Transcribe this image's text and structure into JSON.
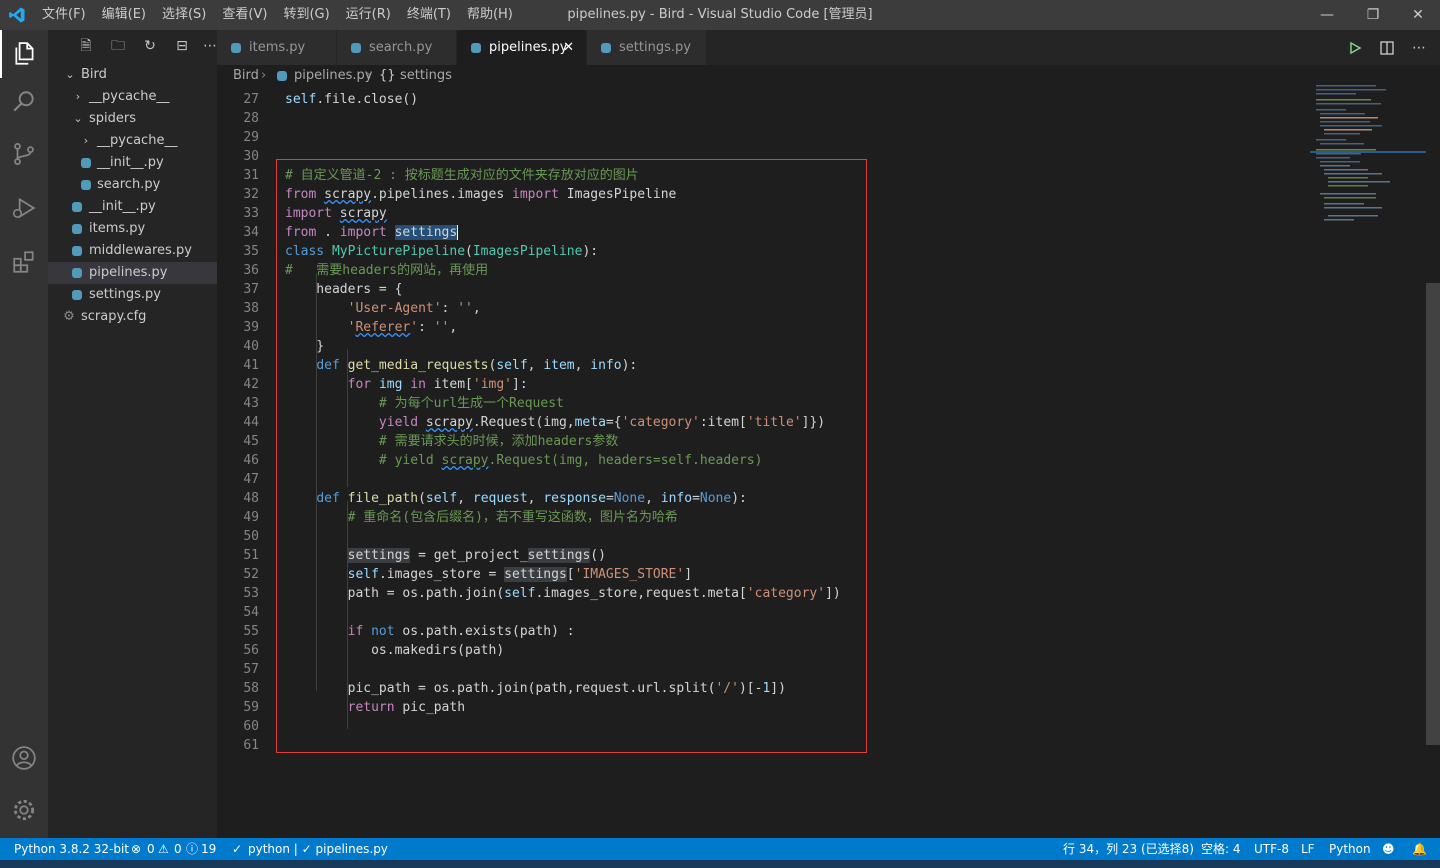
{
  "titlebar": {
    "title": "pipelines.py - Bird - Visual Studio Code [管理员]",
    "menu": [
      "文件(F)",
      "编辑(E)",
      "选择(S)",
      "查看(V)",
      "转到(G)",
      "运行(R)",
      "终端(T)",
      "帮助(H)"
    ]
  },
  "explorer": {
    "items": [
      {
        "label": "Bird",
        "type": "folder-open"
      },
      {
        "label": "__pycache__",
        "type": "folder"
      },
      {
        "label": "spiders",
        "type": "folder-open"
      },
      {
        "label": "__pycache__",
        "type": "folder"
      },
      {
        "label": "__init__.py",
        "type": "py"
      },
      {
        "label": "search.py",
        "type": "py"
      },
      {
        "label": "__init__.py",
        "type": "py"
      },
      {
        "label": "items.py",
        "type": "py"
      },
      {
        "label": "middlewares.py",
        "type": "py"
      },
      {
        "label": "pipelines.py",
        "type": "py",
        "selected": true
      },
      {
        "label": "settings.py",
        "type": "py"
      },
      {
        "label": "scrapy.cfg",
        "type": "cfg"
      }
    ]
  },
  "tabs": [
    {
      "label": "items.py"
    },
    {
      "label": "search.py"
    },
    {
      "label": "pipelines.py",
      "active": true
    },
    {
      "label": "settings.py"
    }
  ],
  "breadcrumb": {
    "root": "Bird",
    "file": "pipelines.py",
    "symbol": "settings"
  },
  "editor": {
    "line_numbers": [
      "27",
      "28",
      "29",
      "30",
      "31",
      "32",
      "33",
      "34",
      "35",
      "36",
      "37",
      "38",
      "39",
      "40",
      "41",
      "42",
      "43",
      "44",
      "45",
      "46",
      "47",
      "48",
      "49",
      "50",
      "51",
      "52",
      "53",
      "54",
      "55",
      "56",
      "57",
      "58",
      "59",
      "60",
      "61"
    ]
  },
  "statusbar": {
    "python": "Python 3.8.2 32-bit",
    "problems_errors": "0",
    "problems_warnings": "0",
    "problems_info": "19",
    "check": "python | ✓ pipelines.py",
    "position": "行 34，列 23 (已选择8)",
    "spaces": "空格: 4",
    "encoding": "UTF-8",
    "eol": "LF",
    "language": "Python"
  }
}
